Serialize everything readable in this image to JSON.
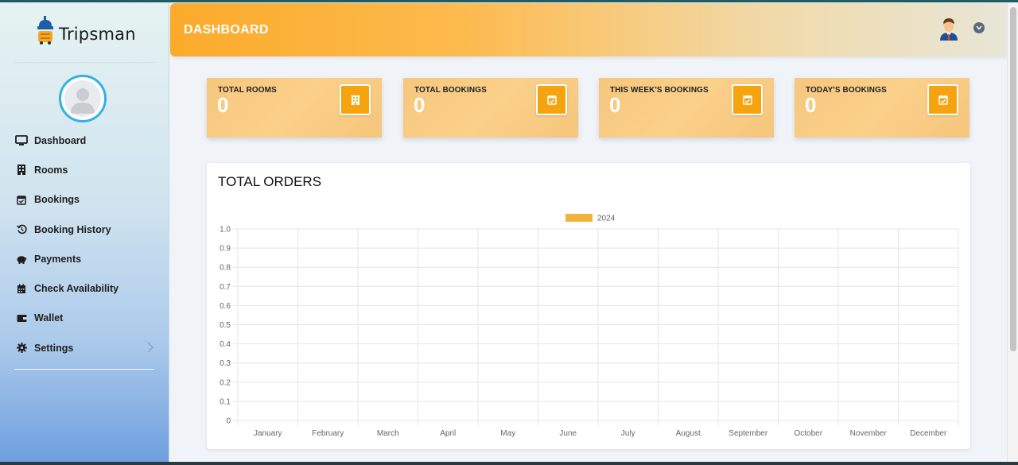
{
  "brand": {
    "name": "Tripsman"
  },
  "sidebar": {
    "items": [
      {
        "label": "Dashboard",
        "icon": "monitor-icon"
      },
      {
        "label": "Rooms",
        "icon": "building-icon"
      },
      {
        "label": "Bookings",
        "icon": "calendar-check-icon"
      },
      {
        "label": "Booking History",
        "icon": "history-icon"
      },
      {
        "label": "Payments",
        "icon": "piggy-bank-icon"
      },
      {
        "label": "Check Availability",
        "icon": "calendar-icon"
      },
      {
        "label": "Wallet",
        "icon": "wallet-icon"
      },
      {
        "label": "Settings",
        "icon": "gear-icon"
      }
    ]
  },
  "header": {
    "title": "DASHBOARD"
  },
  "stats": [
    {
      "title": "TOTAL ROOMS",
      "value": "0",
      "icon": "building-icon"
    },
    {
      "title": "TOTAL BOOKINGS",
      "value": "0",
      "icon": "calendar-check-icon"
    },
    {
      "title": "THIS WEEK'S BOOKINGS",
      "value": "0",
      "icon": "calendar-check-icon"
    },
    {
      "title": "TODAY'S BOOKINGS",
      "value": "0",
      "icon": "calendar-check-icon"
    }
  ],
  "colors": {
    "accent": "#f5a30e",
    "card": "#f8cb81",
    "series": "#f2b33d"
  },
  "orders": {
    "title": "TOTAL ORDERS"
  },
  "chart_data": {
    "type": "bar",
    "categories": [
      "January",
      "February",
      "March",
      "April",
      "May",
      "June",
      "July",
      "August",
      "September",
      "October",
      "November",
      "December"
    ],
    "series": [
      {
        "name": "2024",
        "values": [
          0,
          0,
          0,
          0,
          0,
          0,
          0,
          0,
          0,
          0,
          0,
          0
        ],
        "color": "#f2b33d"
      }
    ],
    "ylim": [
      0,
      1
    ],
    "yticks": [
      "1.0",
      "0.9",
      "0.8",
      "0.7",
      "0.6",
      "0.5",
      "0.4",
      "0.3",
      "0.2",
      "0.1",
      "0"
    ],
    "grid": true,
    "legend": "top-center"
  }
}
